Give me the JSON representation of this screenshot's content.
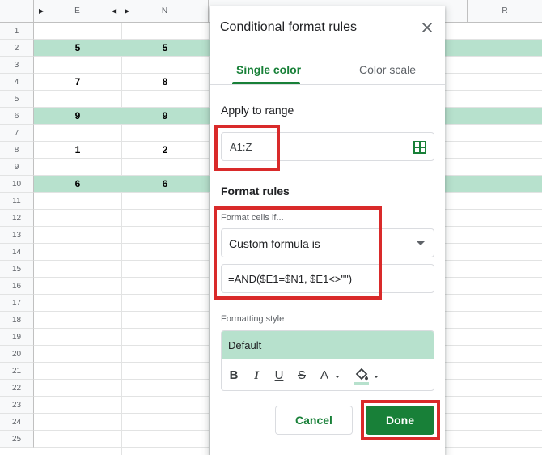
{
  "sheet": {
    "columns": [
      {
        "label": "",
        "id": "corner"
      },
      {
        "label": "E",
        "id": "e"
      },
      {
        "label": "N",
        "id": "n"
      },
      {
        "label": "R",
        "id": "r"
      }
    ],
    "rows": [
      "1",
      "2",
      "3",
      "4",
      "5",
      "6",
      "7",
      "8",
      "9",
      "10",
      "11",
      "12",
      "13",
      "14",
      "15",
      "16",
      "17",
      "18",
      "19",
      "20",
      "21",
      "22",
      "23",
      "24",
      "25"
    ],
    "cells": {
      "r2_e": "5",
      "r2_n": "5",
      "r4_e": "7",
      "r4_n": "8",
      "r6_e": "9",
      "r6_n": "9",
      "r8_e": "1",
      "r8_n": "2",
      "r10_e": "6",
      "r10_n": "6"
    },
    "highlight_color": "#b7e1cd"
  },
  "dialog": {
    "title": "Conditional format rules",
    "close_icon": "close-icon",
    "tabs": {
      "single": "Single color",
      "scale": "Color scale"
    },
    "apply_to_range_label": "Apply to range",
    "range_value": "A1:Z",
    "range_icon": "grid-select-icon",
    "format_rules_label": "Format rules",
    "format_cells_if_label": "Format cells if...",
    "condition_selected": "Custom formula is",
    "formula_value": "=AND($E1=$N1, $E1<>\"\")",
    "formatting_style_label": "Formatting style",
    "style_preview": "Default",
    "toolbar": {
      "bold": "B",
      "italic": "I",
      "underline": "U",
      "strikethrough": "S",
      "text_color": "A"
    },
    "cancel_label": "Cancel",
    "done_label": "Done",
    "accent_color": "#188038",
    "highlight_frame_color": "#d92a2a"
  }
}
